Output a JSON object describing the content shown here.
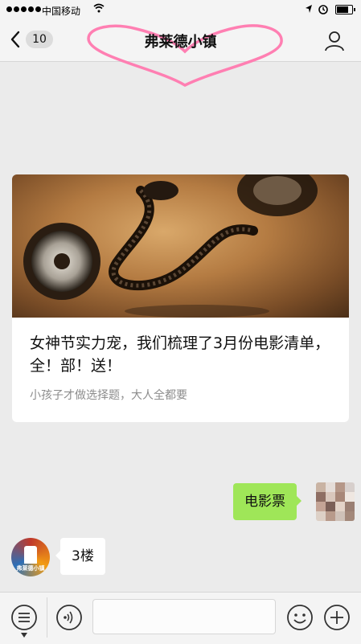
{
  "status_bar": {
    "carrier": "中国移动",
    "battery_level": 0.9
  },
  "nav": {
    "back_count": "10",
    "title": "弗莱德小镇"
  },
  "article": {
    "title": "女神节实力宠，我们梳理了3月份电影清单，全！部！送！",
    "subtitle": "小孩子才做选择题，大人全都要"
  },
  "messages": {
    "sent_text": "电影票",
    "received_text": "3楼",
    "received_avatar_text": "弗莱德小镇"
  },
  "input": {
    "value": ""
  },
  "colors": {
    "sent_bubble": "#9fe658",
    "heart_outline": "#ff7fb2"
  },
  "icons": {
    "back": "chevron-left-icon",
    "profile": "person-icon",
    "menu": "list-icon",
    "voice": "sound-wave-icon",
    "emoji": "smile-icon",
    "add": "plus-icon"
  }
}
